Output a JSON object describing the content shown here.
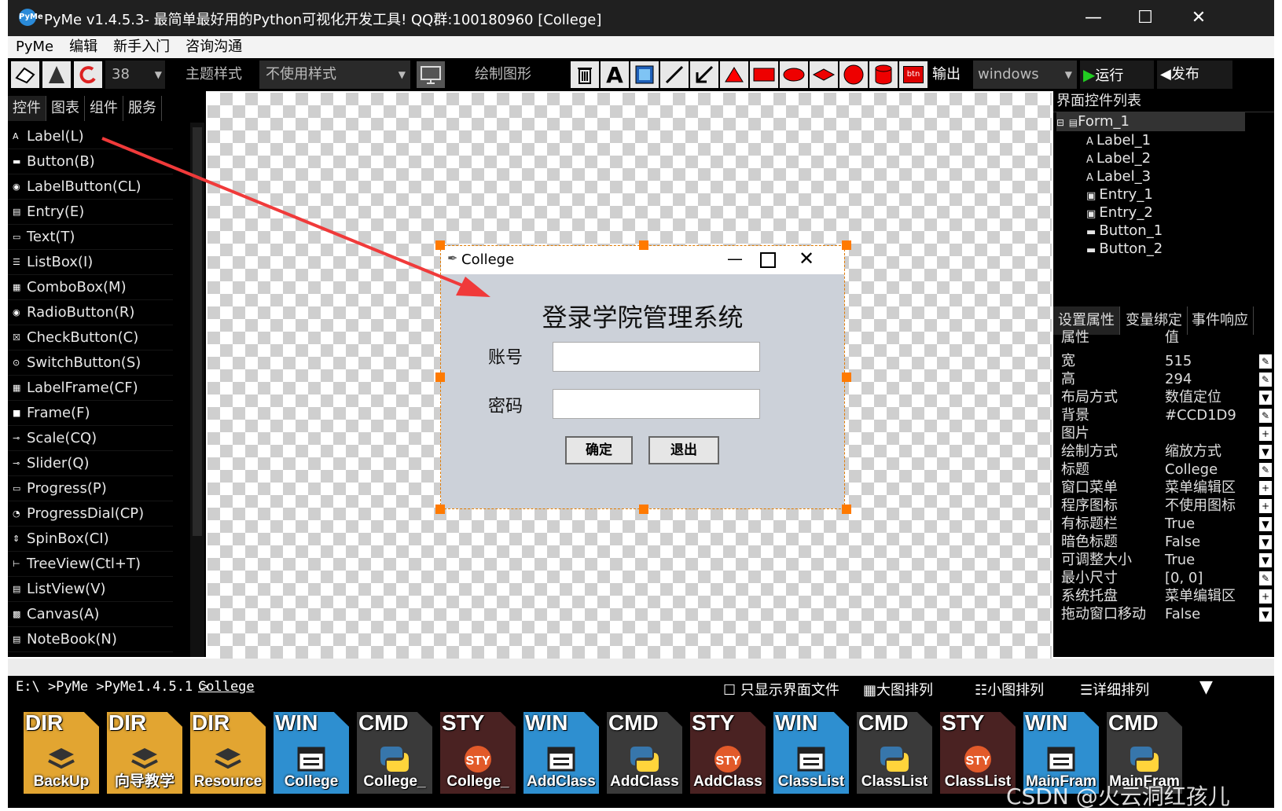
{
  "window": {
    "title": "PyMe v1.4.5.3- 最简单最好用的Python可视化开发工具! QQ群:100180960    [College]",
    "logo_text": "PyMe",
    "minimize": "—",
    "maximize": "☐",
    "close": "✕"
  },
  "menu": [
    "PyMe",
    "编辑",
    "新手入门",
    "咨询沟通"
  ],
  "toolbar": {
    "font_size": "38",
    "theme_label": "主题样式",
    "style_value": "不使用样式",
    "draw_label": "绘制图形",
    "text_tool": "A",
    "btn_badge": "btn",
    "output_label": "输出",
    "platform_value": "windows",
    "run_label": "运行",
    "publish_label": "发布"
  },
  "left_tabs": [
    "控件",
    "图表",
    "组件",
    "服务"
  ],
  "controls": [
    "Label(L)",
    "Button(B)",
    "LabelButton(CL)",
    "Entry(E)",
    "Text(T)",
    "ListBox(I)",
    "ComboBox(M)",
    "RadioButton(R)",
    "CheckButton(C)",
    "SwitchButton(S)",
    "LabelFrame(CF)",
    "Frame(F)",
    "Scale(CQ)",
    "Slider(Q)",
    "Progress(P)",
    "ProgressDial(CP)",
    "SpinBox(CI)",
    "TreeView(Ctl+T)",
    "ListView(V)",
    "Canvas(A)",
    "NoteBook(N)"
  ],
  "form": {
    "title": "College",
    "heading": "登录学院管理系统",
    "account_label": "账号",
    "password_label": "密码",
    "ok_button": "确定",
    "exit_button": "退出",
    "bg_color": "#CCD1D9"
  },
  "right": {
    "tree_title": "界面控件列表",
    "tree_root": "Form_1",
    "tree_items": [
      "Label_1",
      "Label_2",
      "Label_3",
      "Entry_1",
      "Entry_2",
      "Button_1",
      "Button_2"
    ],
    "tabs": [
      "设置属性",
      "变量绑定",
      "事件响应"
    ],
    "prop_header": "属性",
    "val_header": "值",
    "props": [
      {
        "k": "宽",
        "v": "515"
      },
      {
        "k": "高",
        "v": "294"
      },
      {
        "k": "布局方式",
        "v": "数值定位"
      },
      {
        "k": "背景",
        "v": "#CCD1D9"
      },
      {
        "k": "图片",
        "v": ""
      },
      {
        "k": "绘制方式",
        "v": "缩放方式"
      },
      {
        "k": "标题",
        "v": "College"
      },
      {
        "k": "窗口菜单",
        "v": "菜单编辑区"
      },
      {
        "k": "程序图标",
        "v": "不使用图标"
      },
      {
        "k": "有标题栏",
        "v": "True"
      },
      {
        "k": "暗色标题",
        "v": "False"
      },
      {
        "k": "可调整大小",
        "v": "True"
      },
      {
        "k": "最小尺寸",
        "v": "[0, 0]"
      },
      {
        "k": "系统托盘",
        "v": "菜单编辑区"
      },
      {
        "k": "拖动窗口移动",
        "v": "False"
      }
    ]
  },
  "pathbar": {
    "path": "E:\\ >PyMe >PyMe1.4.5.1 >",
    "current": "College",
    "only_ui": "只显示界面文件",
    "large": "大图排列",
    "small": "小图排列",
    "detail": "详细排列"
  },
  "files": [
    {
      "type": "DIR",
      "name": "BackUp",
      "color": "#e2a531"
    },
    {
      "type": "DIR",
      "name": "向导教学",
      "color": "#e2a531"
    },
    {
      "type": "DIR",
      "name": "Resource",
      "color": "#e2a531"
    },
    {
      "type": "WIN",
      "name": "College",
      "color": "#2e8fd0"
    },
    {
      "type": "CMD",
      "name": "College_",
      "color": "#3a3a3a"
    },
    {
      "type": "STY",
      "name": "College_",
      "color": "#4a2222"
    },
    {
      "type": "WIN",
      "name": "AddClass",
      "color": "#2e8fd0"
    },
    {
      "type": "CMD",
      "name": "AddClass",
      "color": "#3a3a3a"
    },
    {
      "type": "STY",
      "name": "AddClass",
      "color": "#4a2222"
    },
    {
      "type": "WIN",
      "name": "ClassList",
      "color": "#2e8fd0"
    },
    {
      "type": "CMD",
      "name": "ClassList",
      "color": "#3a3a3a"
    },
    {
      "type": "STY",
      "name": "ClassList",
      "color": "#4a2222"
    },
    {
      "type": "WIN",
      "name": "MainFram",
      "color": "#2e8fd0"
    },
    {
      "type": "CMD",
      "name": "MainFram",
      "color": "#3a3a3a"
    }
  ],
  "watermark": "CSDN @火云洞红孩儿"
}
